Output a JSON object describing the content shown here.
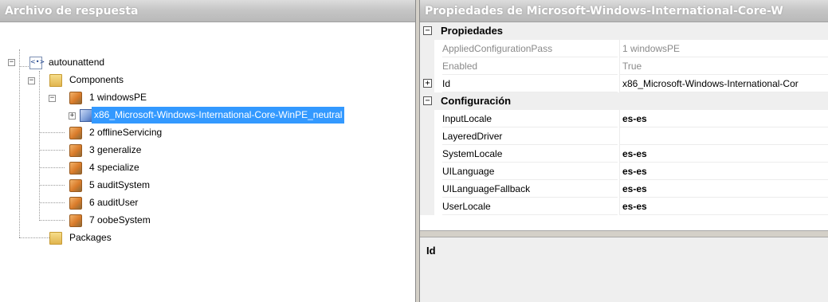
{
  "left_pane": {
    "title": "Archivo de respuesta",
    "tree": [
      {
        "label": "autounattend",
        "icon": "answer-file-icon",
        "expanded": true
      },
      {
        "label": "Components",
        "icon": "folder-icon",
        "expanded": true
      },
      {
        "label": "1 windowsPE",
        "icon": "config-pass-icon",
        "expanded": true
      },
      {
        "label": "x86_Microsoft-Windows-International-Core-WinPE_neutral",
        "icon": "component-icon",
        "expanded": false,
        "selected": true
      },
      {
        "label": "2 offlineServicing",
        "icon": "config-pass-icon"
      },
      {
        "label": "3 generalize",
        "icon": "config-pass-icon"
      },
      {
        "label": "4 specialize",
        "icon": "config-pass-icon"
      },
      {
        "label": "5 auditSystem",
        "icon": "config-pass-icon"
      },
      {
        "label": "6 auditUser",
        "icon": "config-pass-icon"
      },
      {
        "label": "7 oobeSystem",
        "icon": "config-pass-icon"
      },
      {
        "label": "Packages",
        "icon": "folder-icon"
      }
    ]
  },
  "right_pane": {
    "title": "Propiedades de Microsoft-Windows-International-Core-W",
    "categories": [
      {
        "name": "Propiedades",
        "rows": [
          {
            "name": "AppliedConfigurationPass",
            "value": "1 windowsPE"
          },
          {
            "name": "Enabled",
            "value": "True"
          },
          {
            "name": "Id",
            "value": "x86_Microsoft-Windows-International-Cor"
          }
        ]
      },
      {
        "name": "Configuración",
        "rows": [
          {
            "name": "InputLocale",
            "value": "es-es"
          },
          {
            "name": "LayeredDriver",
            "value": ""
          },
          {
            "name": "SystemLocale",
            "value": "es-es"
          },
          {
            "name": "UILanguage",
            "value": "es-es"
          },
          {
            "name": "UILanguageFallback",
            "value": "es-es"
          },
          {
            "name": "UserLocale",
            "value": "es-es"
          }
        ]
      }
    ],
    "description": {
      "title": "Id"
    }
  }
}
